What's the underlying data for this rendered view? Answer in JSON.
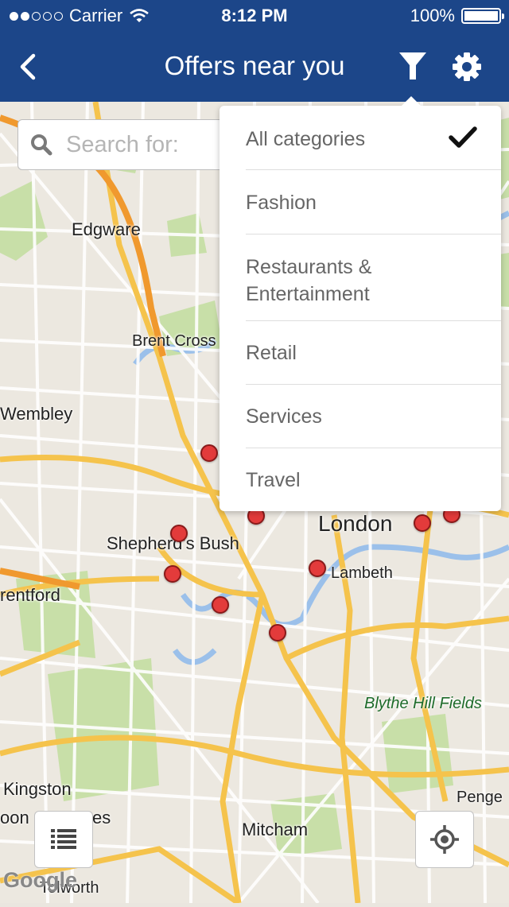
{
  "status": {
    "carrier": "Carrier",
    "time": "8:12 PM",
    "battery": "100%"
  },
  "nav": {
    "title": "Offers near you",
    "back_icon": "chevron-left-icon",
    "filter_icon": "funnel-icon",
    "settings_icon": "gear-icon"
  },
  "search": {
    "placeholder": "Search for:"
  },
  "menu": {
    "items": [
      {
        "label": "All categories",
        "selected": true
      },
      {
        "label": "Fashion"
      },
      {
        "label": "Restaurants & Entertainment"
      },
      {
        "label": "Retail"
      },
      {
        "label": "Services"
      },
      {
        "label": "Travel"
      }
    ]
  },
  "map": {
    "places": [
      "Edgware",
      "Brent Cross",
      "Wembley",
      "London",
      "Shepherd's Bush",
      "Lambeth",
      "rentford",
      "Blythe Hill Fields",
      "Kingston",
      "oon",
      "es",
      "Penge",
      "Mitcham",
      "Tolworth"
    ],
    "attribution": "Google"
  },
  "colors": {
    "nav_bg": "#1c4689",
    "pin": "#e33b3b",
    "road_major": "#f7c64a",
    "motorway": "#f29b2a",
    "park": "#c5dea4",
    "water": "#8fb8e8"
  }
}
